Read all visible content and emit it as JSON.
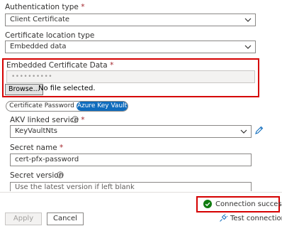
{
  "auth": {
    "label": "Authentication type",
    "required": "*",
    "value": "Client Certificate"
  },
  "cert_location": {
    "label": "Certificate location type",
    "value": "Embedded data"
  },
  "embedded": {
    "label": "Embedded Certificate Data",
    "required": "*",
    "masked_value": "••••••••••",
    "browse_label": "Browse...",
    "no_file_text": "No file selected."
  },
  "tabs": {
    "password": "Certificate Password",
    "akv": "Azure Key Vault",
    "selected": "akv"
  },
  "akv_service": {
    "label": "AKV linked service",
    "required": "*",
    "value": "KeyVaultNts"
  },
  "secret_name": {
    "label": "Secret name",
    "required": "*",
    "value": "cert-pfx-password"
  },
  "secret_version": {
    "label": "Secret version",
    "placeholder": "Use the latest version if left blank"
  },
  "footer": {
    "apply_label": "Apply",
    "cancel_label": "Cancel",
    "connection_status": "Connection successful",
    "test_connection_label": "Test connection"
  },
  "colors": {
    "accent": "#0f6cbd",
    "highlight": "#d50000",
    "success": "#107c10"
  }
}
